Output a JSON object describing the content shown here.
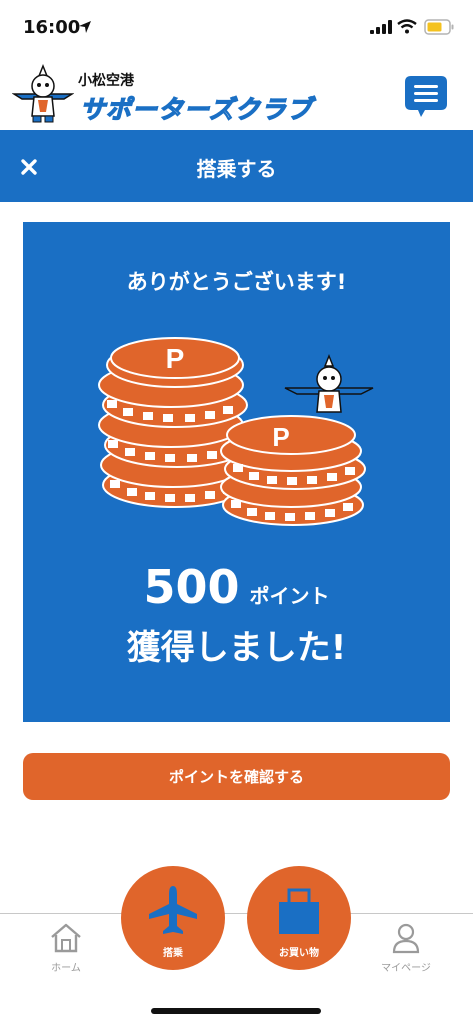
{
  "status_bar": {
    "time": "16:00",
    "icons": [
      "location-arrow-icon",
      "signal-icon",
      "wifi-icon",
      "battery-icon"
    ]
  },
  "header": {
    "logo_small": "小松空港",
    "logo_big": "サポーターズクラブ",
    "menu_icon": "menu-icon"
  },
  "title_bar": {
    "title": "搭乗する",
    "close_icon": "close-icon"
  },
  "card": {
    "thanks": "ありがとうございます!",
    "points_value": "500",
    "points_unit": "ポイント",
    "earned": "獲得しました!",
    "coin_letter": "P"
  },
  "confirm_button": "ポイントを確認する",
  "bottom_nav": {
    "home": "ホーム",
    "board": "搭乗",
    "shop": "お買い物",
    "mypage": "マイページ"
  },
  "colors": {
    "primary_blue": "#1a6fc4",
    "accent_orange": "#e0652b"
  }
}
